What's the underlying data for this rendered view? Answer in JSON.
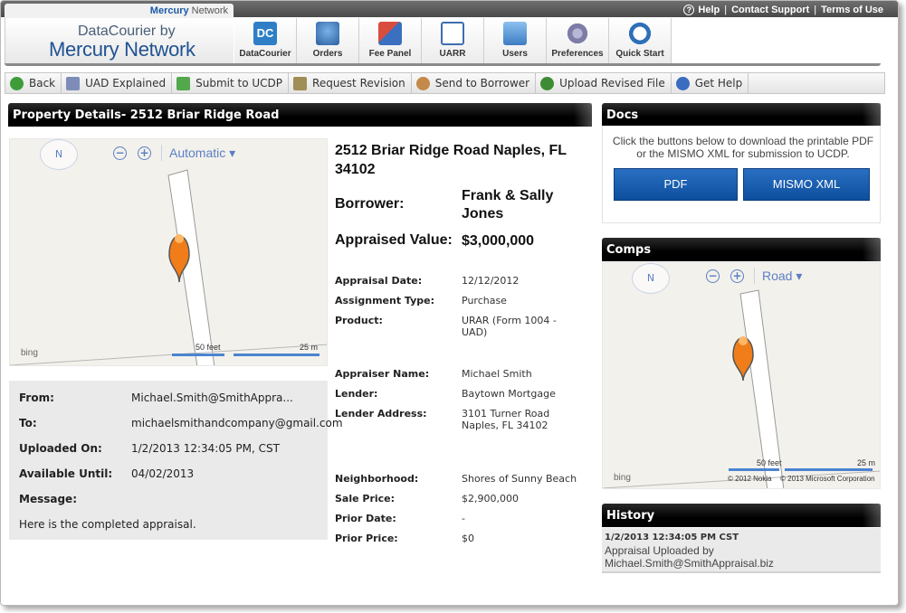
{
  "header": {
    "brand_tab_bold": "Mercury",
    "brand_tab_rest": " Network",
    "logo_line1": "DataCourier by",
    "logo_line2": "Mercury Network",
    "help_icon": "?",
    "links": [
      "Help",
      "Contact Support",
      "Terms of Use"
    ],
    "nav": [
      {
        "label": "DataCourier",
        "icon": "datacourier-icon",
        "icon_text": "DC"
      },
      {
        "label": "Orders",
        "icon": "orders-icon"
      },
      {
        "label": "Fee Panel",
        "icon": "fee-panel-icon"
      },
      {
        "label": "UARR",
        "icon": "uarr-icon"
      },
      {
        "label": "Users",
        "icon": "users-icon"
      },
      {
        "label": "Preferences",
        "icon": "preferences-icon"
      },
      {
        "label": "Quick Start",
        "icon": "quick-start-icon"
      }
    ]
  },
  "toolbar": {
    "buttons": [
      "Back",
      "UAD Explained",
      "Submit to UCDP",
      "Request Revision",
      "Send to Borrower",
      "Upload Revised File",
      "Get Help"
    ]
  },
  "property": {
    "section_title": "Property Details- 2512 Briar Ridge Road",
    "address": "2512 Briar Ridge Road Naples, FL 34102",
    "borrower_label": "Borrower:",
    "borrower": "Frank & Sally Jones",
    "appraised_label": "Appraised Value:",
    "appraised_value": "$3,000,000",
    "details": [
      {
        "label": "Appraisal Date:",
        "value": "12/12/2012"
      },
      {
        "label": "Assignment Type:",
        "value": "Purchase"
      },
      {
        "label": "Product:",
        "value": "URAR (Form 1004 - UAD)"
      },
      {
        "label": "Appraiser Name:",
        "value": "Michael Smith"
      },
      {
        "label": "Lender:",
        "value": "Baytown Mortgage"
      },
      {
        "label": "Lender Address:",
        "value": "3101 Turner Road Naples, FL 34102"
      },
      {
        "label": "Neighborhood:",
        "value": "Shores of Sunny Beach"
      },
      {
        "label": "Sale Price:",
        "value": "$2,900,000"
      },
      {
        "label": "Prior Date:",
        "value": "-"
      },
      {
        "label": "Prior Price:",
        "value": "$0"
      }
    ]
  },
  "map_main": {
    "compass": "N",
    "zoom_out": "−",
    "zoom_in": "+",
    "mode": "Automatic ▾",
    "bing": "bing",
    "scale_feet": "50 feet",
    "scale_m": "25 m"
  },
  "message": {
    "from_label": "From:",
    "from": "Michael.Smith@SmithAppra...",
    "to_label": "To:",
    "to": "michaelsmithandcompany@gmail.com",
    "uploaded_label": "Uploaded On:",
    "uploaded": "1/2/2013 12:34:05 PM, CST",
    "available_label": "Available Until:",
    "available": "04/02/2013",
    "message_label": "Message:",
    "message": "Here is the completed appraisal."
  },
  "docs": {
    "title": "Docs",
    "text": "Click the buttons below to download the printable PDF or the MISMO XML for submission to UCDP.",
    "pdf": "PDF",
    "mismo": "MISMO XML"
  },
  "comps": {
    "title": "Comps",
    "compass": "N",
    "zoom_out": "−",
    "zoom_in": "+",
    "mode": "Road ▾",
    "bing": "bing",
    "scale_feet": "50 feet",
    "scale_m": "25 m",
    "copyright_1": "© 2012 Nokia",
    "copyright_2": "© 2013 Microsoft Corporation"
  },
  "history": {
    "title": "History",
    "date": "1/2/2013 12:34:05 PM CST",
    "text": "Appraisal Uploaded by Michael.Smith@SmithAppraisal.biz"
  },
  "colors": {
    "accent": "#1f5293",
    "header_bg": "#000000",
    "button_blue": "#0d4f9e",
    "marker_orange": "#f07d1a"
  }
}
